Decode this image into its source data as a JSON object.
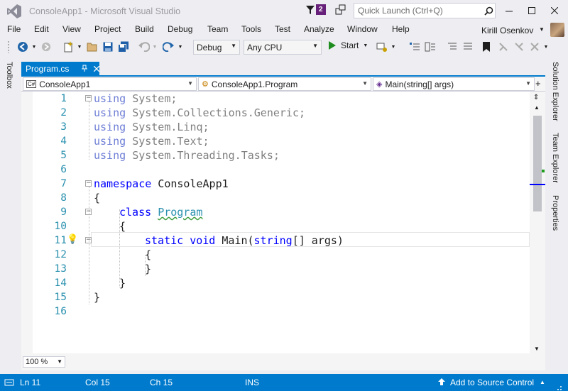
{
  "titlebar": {
    "title": "ConsoleApp1 - Microsoft Visual Studio",
    "notifications_count": "2",
    "quick_launch_placeholder": "Quick Launch (Ctrl+Q)",
    "accent": "#68217a"
  },
  "menu": {
    "items": [
      "File",
      "Edit",
      "View",
      "Project",
      "Build",
      "Debug",
      "Team",
      "Tools",
      "Test",
      "Analyze",
      "Window",
      "Help"
    ],
    "user_name": "Kirill Osenkov"
  },
  "toolbar": {
    "configuration": "Debug",
    "platform": "Any CPU",
    "start_label": "Start"
  },
  "side_tabs": {
    "left": [
      "Toolbox"
    ],
    "right": [
      "Solution Explorer",
      "Team Explorer",
      "Properties"
    ]
  },
  "document": {
    "tab_label": "Program.cs",
    "nav_project": "ConsoleApp1",
    "nav_class": "ConsoleApp1.Program",
    "nav_member": "Main(string[] args)"
  },
  "code": {
    "lines": [
      {
        "n": "1",
        "text": "using System;"
      },
      {
        "n": "2",
        "text": "using System.Collections.Generic;"
      },
      {
        "n": "3",
        "text": "using System.Linq;"
      },
      {
        "n": "4",
        "text": "using System.Text;"
      },
      {
        "n": "5",
        "text": "using System.Threading.Tasks;"
      },
      {
        "n": "6",
        "text": ""
      },
      {
        "n": "7",
        "text": "namespace ConsoleApp1"
      },
      {
        "n": "8",
        "text": "{"
      },
      {
        "n": "9",
        "text": "class Program"
      },
      {
        "n": "10",
        "text": "{"
      },
      {
        "n": "11",
        "text": "static void Main(string[] args)"
      },
      {
        "n": "12",
        "text": "{"
      },
      {
        "n": "13",
        "text": "}"
      },
      {
        "n": "14",
        "text": "}"
      },
      {
        "n": "15",
        "text": "}"
      },
      {
        "n": "16",
        "text": ""
      }
    ]
  },
  "editor": {
    "zoom": "100 %"
  },
  "statusbar": {
    "line": "Ln 11",
    "column": "Col 15",
    "char": "Ch 15",
    "mode": "INS",
    "source_control": "Add to Source Control",
    "color": "#007acc"
  }
}
